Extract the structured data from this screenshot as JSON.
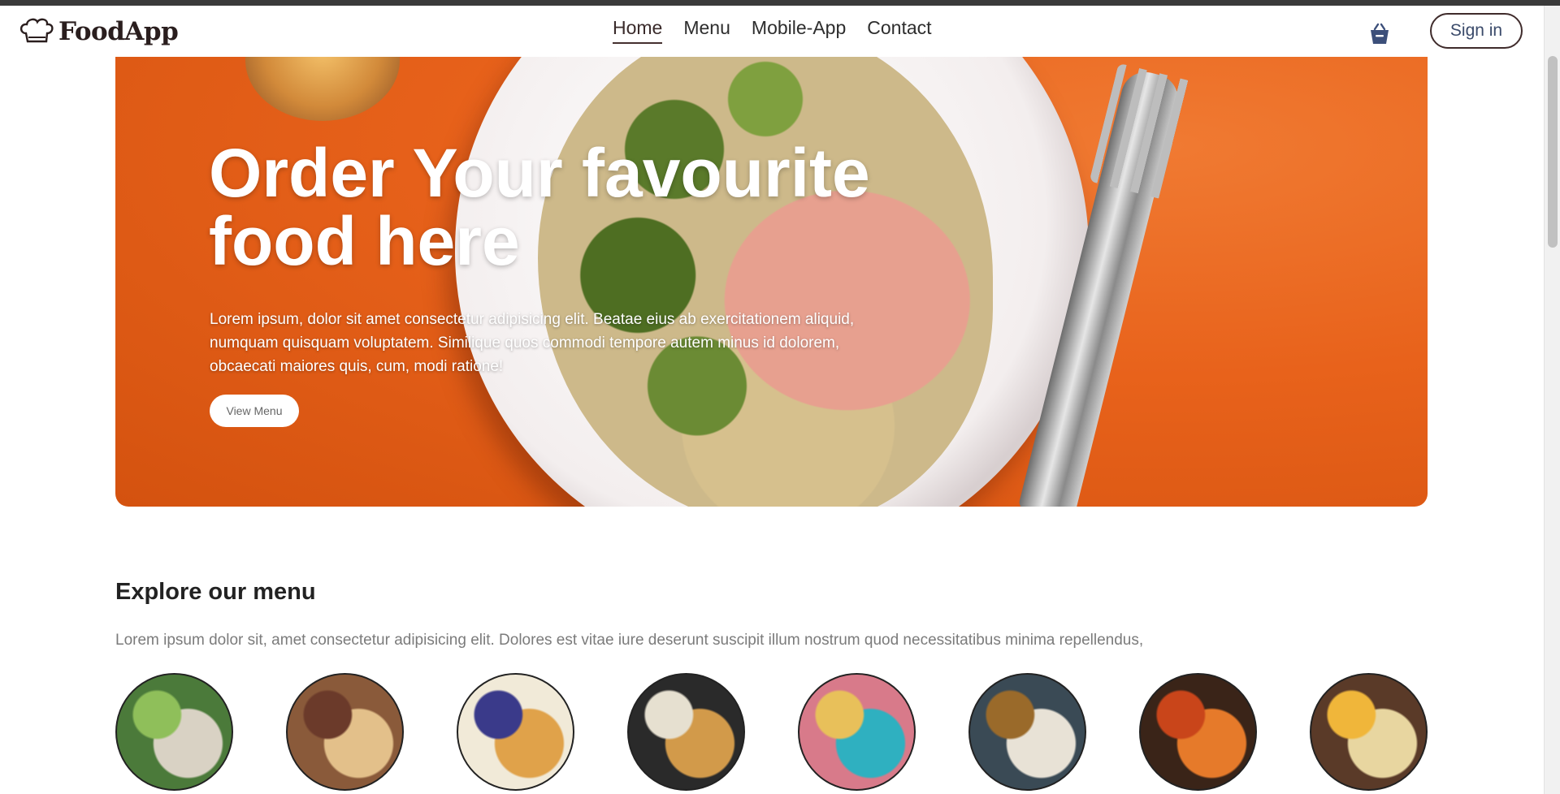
{
  "navbar": {
    "logo_text": "FoodApp",
    "links": [
      {
        "label": "Home",
        "active": true
      },
      {
        "label": "Menu",
        "active": false
      },
      {
        "label": "Mobile-App",
        "active": false
      },
      {
        "label": "Contact",
        "active": false
      }
    ],
    "cart_icon": "basket-icon",
    "signin_label": "Sign in"
  },
  "hero": {
    "title": "Order Your favourite food here",
    "text": "Lorem ipsum, dolor sit amet consectetur adipisicing elit. Beatae eius ab exercitationem aliquid, numquam quisquam voluptatem. Similique quos commodi tempore autem minus id dolorem, obcaecati maiores quis, cum, modi ratione!",
    "button_label": "View Menu"
  },
  "explore": {
    "title": "Explore our menu",
    "text": "Lorem ipsum dolor sit, amet consectetur adipisicing elit. Dolores est vitae iure deserunt suscipit illum nostrum quod necessitatibus minima repellendus,",
    "items": [
      {
        "name": "menu-item-salad",
        "colors": [
          "#4b7a3a",
          "#d9d2c4",
          "#8fbf5a"
        ]
      },
      {
        "name": "menu-item-rolls",
        "colors": [
          "#8a5a3a",
          "#e3c08a",
          "#6b3a2a"
        ]
      },
      {
        "name": "menu-item-deserts",
        "colors": [
          "#f1ead8",
          "#e0a24a",
          "#3a3a8a"
        ]
      },
      {
        "name": "menu-item-sandwich",
        "colors": [
          "#2a2a2a",
          "#d29a4a",
          "#e6e0d0"
        ]
      },
      {
        "name": "menu-item-cake",
        "colors": [
          "#d87a8a",
          "#2fb0c0",
          "#e8c05a"
        ]
      },
      {
        "name": "menu-item-pure-veg",
        "colors": [
          "#3a4a55",
          "#e8e2d6",
          "#9a6a2a"
        ]
      },
      {
        "name": "menu-item-pasta",
        "colors": [
          "#3a2418",
          "#e67a2a",
          "#c9451a"
        ]
      },
      {
        "name": "menu-item-noodles",
        "colors": [
          "#5a3a28",
          "#e8d6a0",
          "#f0b63a"
        ]
      }
    ]
  }
}
